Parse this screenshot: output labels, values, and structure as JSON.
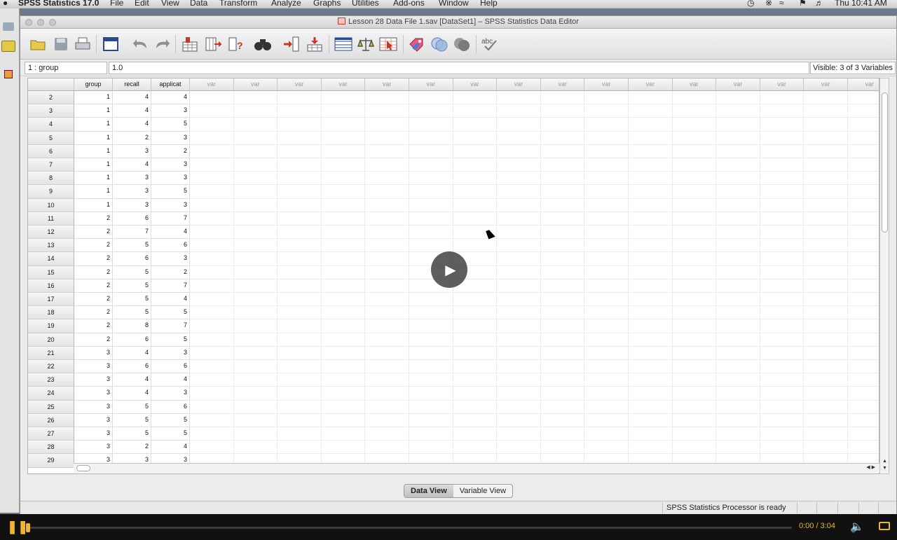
{
  "menubar": {
    "app": "SPSS Statistics 17.0",
    "items": [
      "File",
      "Edit",
      "View",
      "Data",
      "Transform",
      "Analyze",
      "Graphs",
      "Utilities",
      "Add-ons",
      "Window",
      "Help"
    ],
    "clock": "Thu 10:41 AM"
  },
  "window": {
    "title": "Lesson 28 Data File 1.sav [DataSet1] – SPSS Statistics Data Editor"
  },
  "toolbar": {
    "icons": [
      "open-folder-icon",
      "save-icon",
      "print-icon",
      "dialog-recall-icon",
      "undo-icon",
      "redo-icon",
      "go-to-case-icon",
      "go-to-variable-icon",
      "variables-info-icon",
      "find-icon",
      "insert-variable-icon",
      "insert-case-icon",
      "split-file-icon",
      "weight-cases-icon",
      "select-cases-icon",
      "value-labels-icon",
      "use-sets-icon",
      "show-all-variables-icon",
      "spell-check-icon"
    ]
  },
  "cell_editor": {
    "ref": "1 : group",
    "value": "1.0",
    "visible": "Visible: 3 of 3 Variables"
  },
  "grid": {
    "columns": [
      "group",
      "recall",
      "applicat"
    ],
    "empty_col_label": "var",
    "rows": [
      {
        "n": "2",
        "v": [
          "1",
          "4",
          "4"
        ]
      },
      {
        "n": "3",
        "v": [
          "1",
          "4",
          "3"
        ]
      },
      {
        "n": "4",
        "v": [
          "1",
          "4",
          "5"
        ]
      },
      {
        "n": "5",
        "v": [
          "1",
          "2",
          "3"
        ]
      },
      {
        "n": "6",
        "v": [
          "1",
          "3",
          "2"
        ]
      },
      {
        "n": "7",
        "v": [
          "1",
          "4",
          "3"
        ]
      },
      {
        "n": "8",
        "v": [
          "1",
          "3",
          "3"
        ]
      },
      {
        "n": "9",
        "v": [
          "1",
          "3",
          "5"
        ]
      },
      {
        "n": "10",
        "v": [
          "1",
          "3",
          "3"
        ]
      },
      {
        "n": "11",
        "v": [
          "2",
          "6",
          "7"
        ]
      },
      {
        "n": "12",
        "v": [
          "2",
          "7",
          "4"
        ]
      },
      {
        "n": "13",
        "v": [
          "2",
          "5",
          "6"
        ]
      },
      {
        "n": "14",
        "v": [
          "2",
          "6",
          "3"
        ]
      },
      {
        "n": "15",
        "v": [
          "2",
          "5",
          "2"
        ]
      },
      {
        "n": "16",
        "v": [
          "2",
          "5",
          "7"
        ]
      },
      {
        "n": "17",
        "v": [
          "2",
          "5",
          "4"
        ]
      },
      {
        "n": "18",
        "v": [
          "2",
          "5",
          "5"
        ]
      },
      {
        "n": "19",
        "v": [
          "2",
          "8",
          "7"
        ]
      },
      {
        "n": "20",
        "v": [
          "2",
          "6",
          "5"
        ]
      },
      {
        "n": "21",
        "v": [
          "3",
          "4",
          "3"
        ]
      },
      {
        "n": "22",
        "v": [
          "3",
          "6",
          "6"
        ]
      },
      {
        "n": "23",
        "v": [
          "3",
          "4",
          "4"
        ]
      },
      {
        "n": "24",
        "v": [
          "3",
          "4",
          "3"
        ]
      },
      {
        "n": "25",
        "v": [
          "3",
          "5",
          "6"
        ]
      },
      {
        "n": "26",
        "v": [
          "3",
          "5",
          "5"
        ]
      },
      {
        "n": "27",
        "v": [
          "3",
          "5",
          "5"
        ]
      },
      {
        "n": "28",
        "v": [
          "3",
          "2",
          "4"
        ]
      },
      {
        "n": "29",
        "v": [
          "3",
          "3",
          "3"
        ]
      }
    ]
  },
  "tabs": {
    "data_view": "Data View",
    "variable_view": "Variable View",
    "active": "data_view"
  },
  "status": {
    "text": "SPSS Statistics  Processor is ready"
  },
  "player": {
    "time": "0:00 / 3:04",
    "progress": 0
  },
  "colors": {
    "player_accent": "#f0b52e"
  }
}
